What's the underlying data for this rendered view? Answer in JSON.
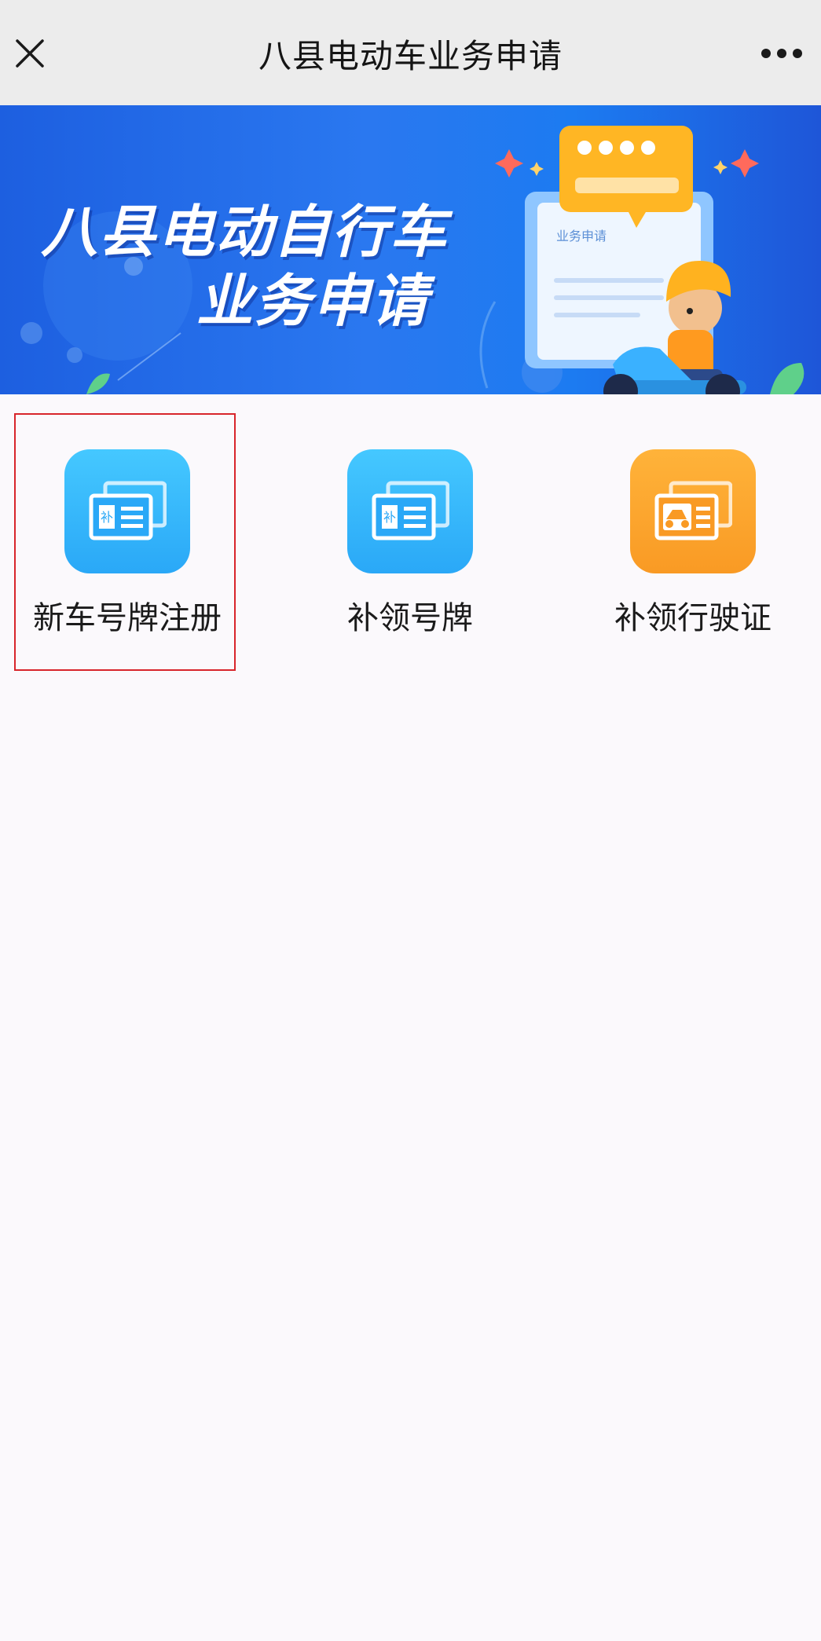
{
  "header": {
    "title": "八县电动车业务申请",
    "close_icon": "close-icon",
    "more_icon": "more-dots-icon"
  },
  "banner": {
    "line1": "八县电动自行车",
    "line2": "业务申请",
    "card_text": "业务申请"
  },
  "services": [
    {
      "label": "新车号牌注册",
      "icon": "plate-card-icon",
      "color": "#2aa8f7",
      "badge": "补"
    },
    {
      "label": "补领号牌",
      "icon": "plate-card-icon",
      "color": "#2aa8f7",
      "badge": "补"
    },
    {
      "label": "补领行驶证",
      "icon": "license-card-icon",
      "color": "#f99a24"
    }
  ],
  "highlight_color": "#d8252b"
}
